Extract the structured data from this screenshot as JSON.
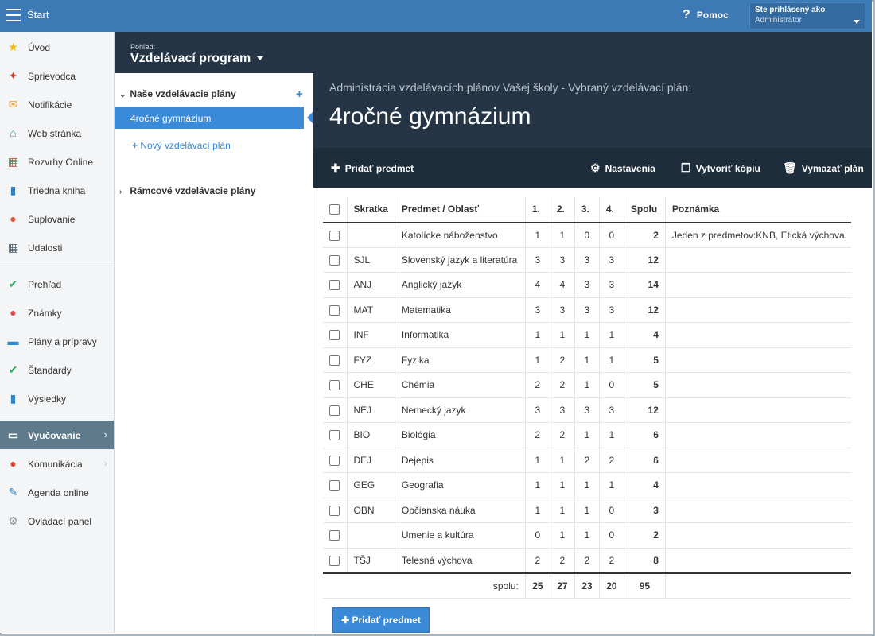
{
  "topbar": {
    "start_label": "Štart",
    "help_label": "Pomoc",
    "user_label": "Ste prihlásený ako",
    "user_name": "Administrátor"
  },
  "sidebar": {
    "items": [
      {
        "label": "Úvod",
        "icon": "star-icon",
        "glyph": "★",
        "color": "#f2b705"
      },
      {
        "label": "Sprievodca",
        "icon": "wand-icon",
        "glyph": "✦",
        "color": "#d9412b"
      },
      {
        "label": "Notifikácie",
        "icon": "envelope-icon",
        "glyph": "✉",
        "color": "#f0a020"
      },
      {
        "label": "Web stránka",
        "icon": "house-icon",
        "glyph": "⌂",
        "color": "#2a9d8f"
      },
      {
        "label": "Rozvrhy Online",
        "icon": "calendar-grid-icon",
        "glyph": "▦",
        "color": "#d9412b"
      },
      {
        "label": "Triedna kniha",
        "icon": "book-icon",
        "glyph": "▮",
        "color": "#2f7fc1"
      },
      {
        "label": "Suplovanie",
        "icon": "user-icon",
        "glyph": "●",
        "color": "#e2553b"
      },
      {
        "label": "Udalosti",
        "icon": "calendar-icon",
        "glyph": "▦",
        "color": "#3b5b7a"
      },
      {
        "label": "Prehľad",
        "icon": "check-circle-icon",
        "glyph": "✔",
        "color": "#27ae60"
      },
      {
        "label": "Známky",
        "icon": "grade-icon",
        "glyph": "●",
        "color": "#e04848"
      },
      {
        "label": "Plány a prípravy",
        "icon": "briefcase-icon",
        "glyph": "▬",
        "color": "#2f86c9"
      },
      {
        "label": "Štandardy",
        "icon": "shield-check-icon",
        "glyph": "✔",
        "color": "#27ae60"
      },
      {
        "label": "Výsledky",
        "icon": "bar-chart-icon",
        "glyph": "▮",
        "color": "#2f86c9"
      },
      {
        "label": "Vyučovanie",
        "icon": "open-book-icon",
        "glyph": "▭",
        "color": "#ffffff"
      },
      {
        "label": "Komunikácia",
        "icon": "chat-icon",
        "glyph": "●",
        "color": "#d9412b"
      },
      {
        "label": "Agenda online",
        "icon": "feather-icon",
        "glyph": "✎",
        "color": "#2f86c9"
      },
      {
        "label": "Ovládací panel",
        "icon": "gear-icon",
        "glyph": "⚙",
        "color": "#8a8f94"
      }
    ]
  },
  "view": {
    "label": "Pohľad:",
    "value": "Vzdelávací program"
  },
  "plans_panel": {
    "my_plans_label": "Naše vzdelávacie plány",
    "active_plan": "4ročné gymnázium",
    "new_plan_label": "Nový vzdelávací plán",
    "framework_label": "Rámcové vzdelávacie plány"
  },
  "main": {
    "subtitle": "Administrácia vzdelávacích plánov Vašej školy - Vybraný vzdelávací plán:",
    "title": "4ročné gymnázium"
  },
  "toolbar": {
    "add_subject": "Pridať predmet",
    "settings": "Nastavenia",
    "copy": "Vytvoriť kópiu",
    "delete": "Vymazať plán"
  },
  "table": {
    "headers": {
      "abbr": "Skratka",
      "subject": "Predmet / Oblasť",
      "y1": "1.",
      "y2": "2.",
      "y3": "3.",
      "y4": "4.",
      "total": "Spolu",
      "note": "Poznámka"
    },
    "rows": [
      {
        "abbr": "",
        "subject": "Katolícke náboženstvo",
        "y1": "1",
        "y2": "1",
        "y3": "0",
        "y4": "0",
        "total": "2",
        "note": "Jeden z predmetov:KNB, Etická výchova"
      },
      {
        "abbr": "SJL",
        "subject": "Slovenský jazyk a literatúra",
        "y1": "3",
        "y2": "3",
        "y3": "3",
        "y4": "3",
        "total": "12",
        "note": ""
      },
      {
        "abbr": "ANJ",
        "subject": "Anglický jazyk",
        "y1": "4",
        "y2": "4",
        "y3": "3",
        "y4": "3",
        "total": "14",
        "note": ""
      },
      {
        "abbr": "MAT",
        "subject": "Matematika",
        "y1": "3",
        "y2": "3",
        "y3": "3",
        "y4": "3",
        "total": "12",
        "note": ""
      },
      {
        "abbr": "INF",
        "subject": "Informatika",
        "y1": "1",
        "y2": "1",
        "y3": "1",
        "y4": "1",
        "total": "4",
        "note": ""
      },
      {
        "abbr": "FYZ",
        "subject": "Fyzika",
        "y1": "1",
        "y2": "2",
        "y3": "1",
        "y4": "1",
        "total": "5",
        "note": ""
      },
      {
        "abbr": "CHE",
        "subject": "Chémia",
        "y1": "2",
        "y2": "2",
        "y3": "1",
        "y4": "0",
        "total": "5",
        "note": ""
      },
      {
        "abbr": "NEJ",
        "subject": "Nemecký jazyk",
        "y1": "3",
        "y2": "3",
        "y3": "3",
        "y4": "3",
        "total": "12",
        "note": ""
      },
      {
        "abbr": "BIO",
        "subject": "Biológia",
        "y1": "2",
        "y2": "2",
        "y3": "1",
        "y4": "1",
        "total": "6",
        "note": ""
      },
      {
        "abbr": "DEJ",
        "subject": "Dejepis",
        "y1": "1",
        "y2": "1",
        "y3": "2",
        "y4": "2",
        "total": "6",
        "note": ""
      },
      {
        "abbr": "GEG",
        "subject": "Geografia",
        "y1": "1",
        "y2": "1",
        "y3": "1",
        "y4": "1",
        "total": "4",
        "note": ""
      },
      {
        "abbr": "OBN",
        "subject": "Občianska náuka",
        "y1": "1",
        "y2": "1",
        "y3": "1",
        "y4": "0",
        "total": "3",
        "note": ""
      },
      {
        "abbr": "",
        "subject": "Umenie a kultúra",
        "y1": "0",
        "y2": "1",
        "y3": "1",
        "y4": "0",
        "total": "2",
        "note": ""
      },
      {
        "abbr": "TŠJ",
        "subject": "Telesná výchova",
        "y1": "2",
        "y2": "2",
        "y3": "2",
        "y4": "2",
        "total": "8",
        "note": ""
      }
    ],
    "footer": {
      "label": "spolu:",
      "y1": "25",
      "y2": "27",
      "y3": "23",
      "y4": "20",
      "total": "95"
    }
  },
  "add_button_label": "Pridať predmet"
}
